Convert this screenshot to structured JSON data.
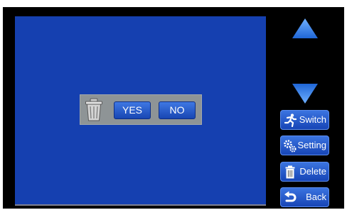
{
  "dialog": {
    "yes_label": "YES",
    "no_label": "NO",
    "icon": "trash-can-icon"
  },
  "sidebar": {
    "scroll_up_icon": "triangle-up-icon",
    "scroll_down_icon": "triangle-down-icon",
    "buttons": [
      {
        "label": "Switch",
        "icon": "running-person-icon"
      },
      {
        "label": "Setting",
        "icon": "gears-icon"
      },
      {
        "label": "Delete",
        "icon": "trash-icon"
      },
      {
        "label": "Back",
        "icon": "back-arrow-icon"
      }
    ]
  },
  "colors": {
    "screen": "#1540b0",
    "bezel": "#000000",
    "button_blue": "#2a5fd0",
    "arrow_blue": "#2d7be0",
    "dialog_gray": "#8e9496"
  }
}
